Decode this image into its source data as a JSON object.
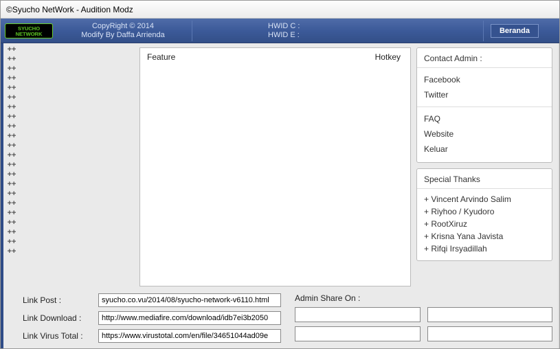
{
  "window": {
    "title": "©Syucho NetWork - Audition Modz"
  },
  "topbar": {
    "brand_line1": "SYUCHO",
    "brand_line2": "NETWORK",
    "copyright": "CopyRight © 2014",
    "modify": "Modify By Daffa Arrienda",
    "hwid_c_label": "HWID C :",
    "hwid_e_label": "HWID E :",
    "beranda": "Beranda"
  },
  "left_rail": {
    "glyph": "++",
    "count": 22
  },
  "feature_panel": {
    "col_feature": "Feature",
    "col_hotkey": "Hotkey"
  },
  "contact_pane": {
    "header": "Contact Admin :",
    "items_a": [
      "Facebook",
      "Twitter"
    ],
    "items_b": [
      "FAQ",
      "Website",
      "Keluar"
    ]
  },
  "thanks_pane": {
    "header": "Special Thanks",
    "items": [
      "+ Vincent Arvindo Salim",
      "+ Riyhoo / Kyudoro",
      "+ RootXiruz",
      "+ Krisna Yana Javista",
      "+ Rifqi Irsyadillah"
    ]
  },
  "links": {
    "post_label": "Link Post :",
    "post_value": "syucho.co.vu/2014/08/syucho-network-v6110.html",
    "download_label": "Link Download :",
    "download_value": "http://www.mediafire.com/download/idb7ei3b2050",
    "virustotal_label": "Link Virus Total :",
    "virustotal_value": "https://www.virustotal.com/en/file/34651044ad09e"
  },
  "share": {
    "label": "Admin Share On :"
  }
}
